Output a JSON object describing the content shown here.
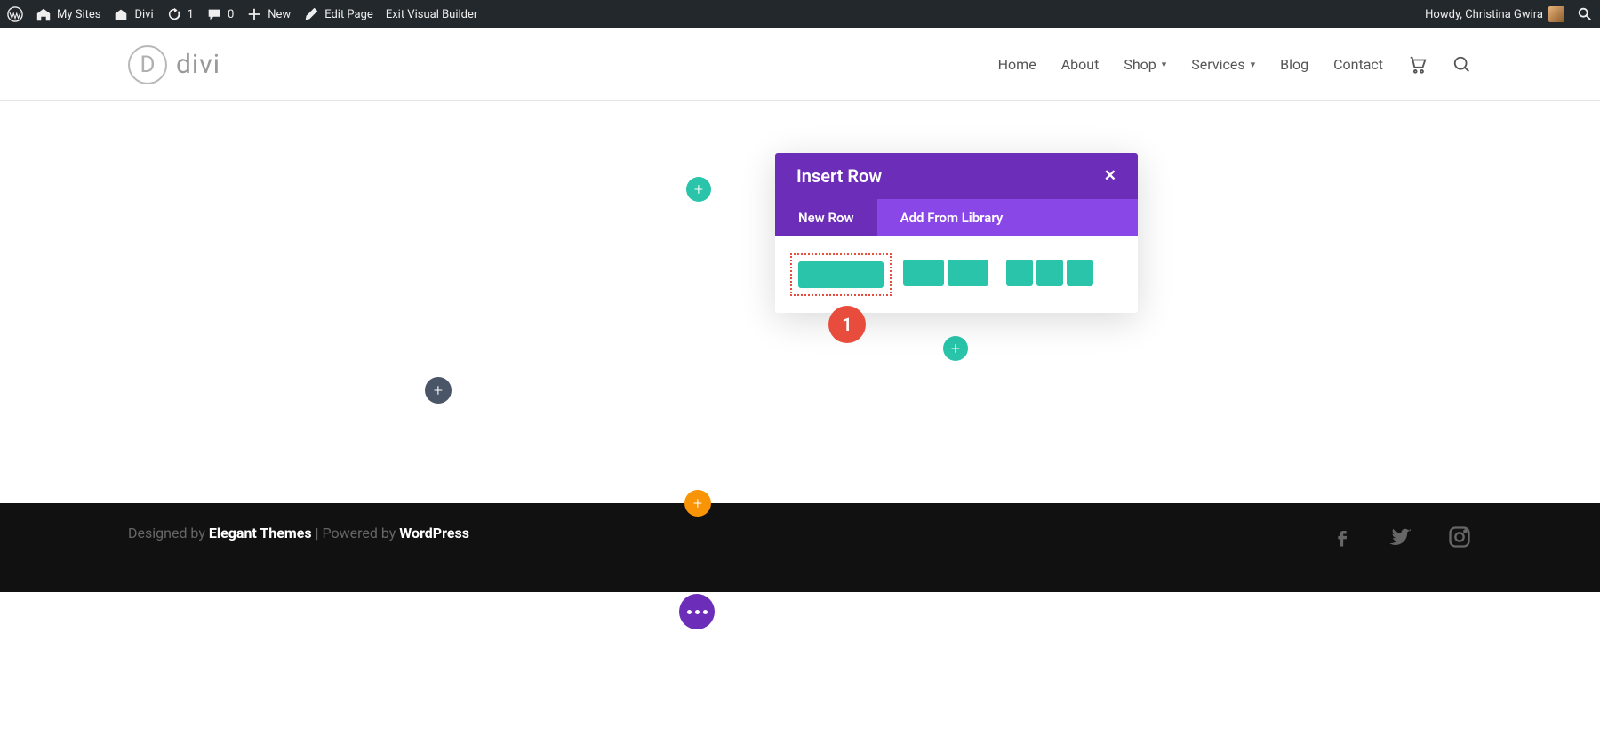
{
  "adminbar": {
    "mysites": "My Sites",
    "site": "Divi",
    "updates": "1",
    "comments": "0",
    "new": "New",
    "edit": "Edit Page",
    "exit": "Exit Visual Builder",
    "howdy": "Howdy, Christina Gwira"
  },
  "header": {
    "logo_letter": "D",
    "logo_text": "divi",
    "nav": {
      "home": "Home",
      "about": "About",
      "shop": "Shop",
      "services": "Services",
      "blog": "Blog",
      "contact": "Contact"
    }
  },
  "modal": {
    "title": "Insert Row",
    "tabs": {
      "newrow": "New Row",
      "library": "Add From Library"
    }
  },
  "marker": {
    "one": "1"
  },
  "footer": {
    "designed_by": "Designed by ",
    "et": "Elegant Themes",
    "sep": " | Powered by ",
    "wp": "WordPress"
  }
}
